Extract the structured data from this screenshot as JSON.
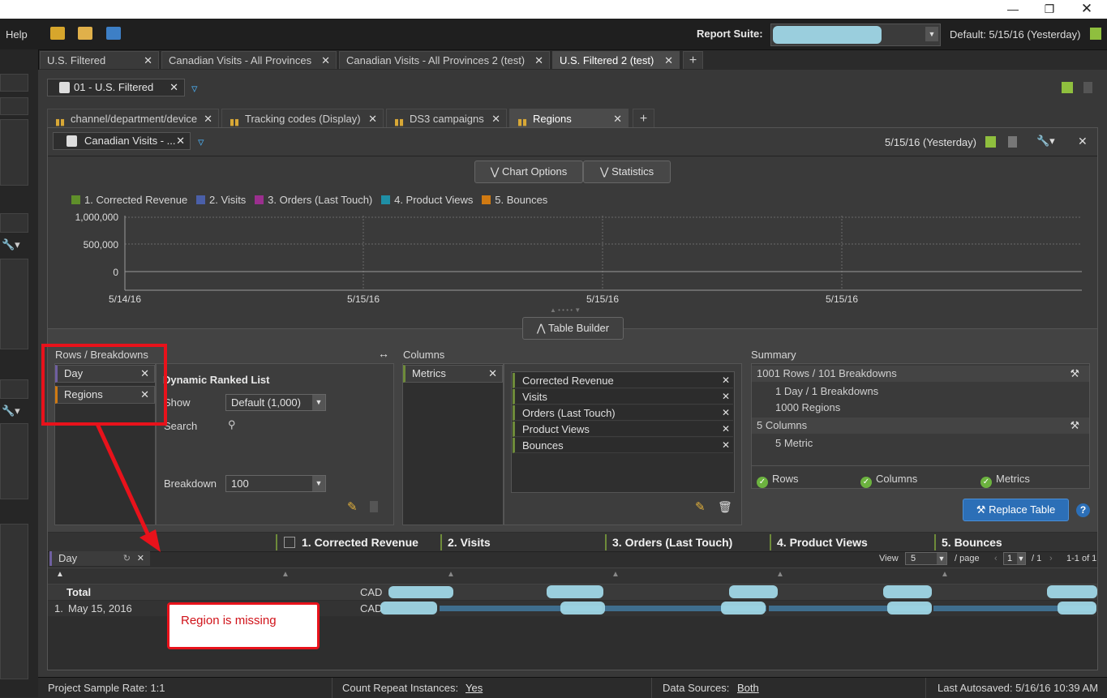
{
  "menu": {
    "help": "Help"
  },
  "header": {
    "report_suite_label": "Report Suite:",
    "default_date": "Default: 5/15/16 (Yesterday)"
  },
  "tabs": [
    {
      "label": "U.S. Filtered"
    },
    {
      "label": "Canadian Visits - All Provinces"
    },
    {
      "label": "Canadian Visits - All Provinces 2 (test)"
    },
    {
      "label": "U.S. Filtered 2 (test)"
    }
  ],
  "segment": {
    "label": "01 - U.S. Filtered"
  },
  "subtabs": [
    {
      "label": "channel/department/device"
    },
    {
      "label": "Tracking codes (Display)"
    },
    {
      "label": "DS3 campaigns"
    },
    {
      "label": "Regions"
    }
  ],
  "panel": {
    "segment": "Canadian Visits - ...",
    "date": "5/15/16 (Yesterday)",
    "chart_options": "Chart Options",
    "statistics": "Statistics",
    "table_builder": "Table Builder"
  },
  "chart_data": {
    "type": "line",
    "series": [
      {
        "name": "1. Corrected Revenue",
        "color": "#5f8f2a"
      },
      {
        "name": "2. Visits",
        "color": "#4a5fa8"
      },
      {
        "name": "3. Orders (Last Touch)",
        "color": "#9b2f8e"
      },
      {
        "name": "4. Product Views",
        "color": "#1f8fa6"
      },
      {
        "name": "5. Bounces",
        "color": "#d07a12"
      }
    ],
    "y_ticks": [
      "1,000,000",
      "500,000",
      "0"
    ],
    "x_ticks": [
      "5/14/16",
      "5/15/16",
      "5/15/16",
      "5/15/16"
    ],
    "ylim": [
      0,
      1000000
    ],
    "grid": true,
    "legend": "top-left"
  },
  "builder": {
    "rows_title": "Rows / Breakdowns",
    "rows": [
      "Day",
      "Regions"
    ],
    "drl_title": "Dynamic Ranked List",
    "show_label": "Show",
    "show_value": "Default (1,000)",
    "search_label": "Search",
    "breakdown_label": "Breakdown",
    "breakdown_value": "100",
    "columns_title": "Columns",
    "metrics_chip": "Metrics",
    "metrics": [
      "Corrected Revenue",
      "Visits",
      "Orders (Last Touch)",
      "Product Views",
      "Bounces"
    ],
    "summary_title": "Summary",
    "summary": {
      "rows": "1001 Rows / 101 Breakdowns",
      "day": "1 Day / 1 Breakdowns",
      "regions": "1000 Regions",
      "columns": "5 Columns",
      "metric": "5 Metric"
    },
    "checks": [
      "Rows",
      "Columns",
      "Metrics"
    ],
    "replace_table": "Replace Table"
  },
  "table": {
    "headers": [
      "1. Corrected Revenue",
      "2. Visits",
      "3. Orders (Last Touch)",
      "4. Product Views",
      "5. Bounces"
    ],
    "row_dim": "Day",
    "view_label": "View",
    "view_value": "5",
    "per_page": "/ page",
    "page": "1",
    "page_total": "/ 1",
    "range": "1-1 of 1",
    "total_label": "Total",
    "row1_index": "1.",
    "row1_label": "May 15, 2016",
    "currency": "CAD"
  },
  "callout": "Region is missing",
  "status": {
    "sample_label": "Project Sample Rate: 1:1",
    "repeat_label": "Count Repeat Instances:",
    "repeat_value": "Yes",
    "sources_label": "Data Sources:",
    "sources_value": "Both",
    "autosave": "Last Autosaved: 5/16/16 10:39 AM"
  }
}
